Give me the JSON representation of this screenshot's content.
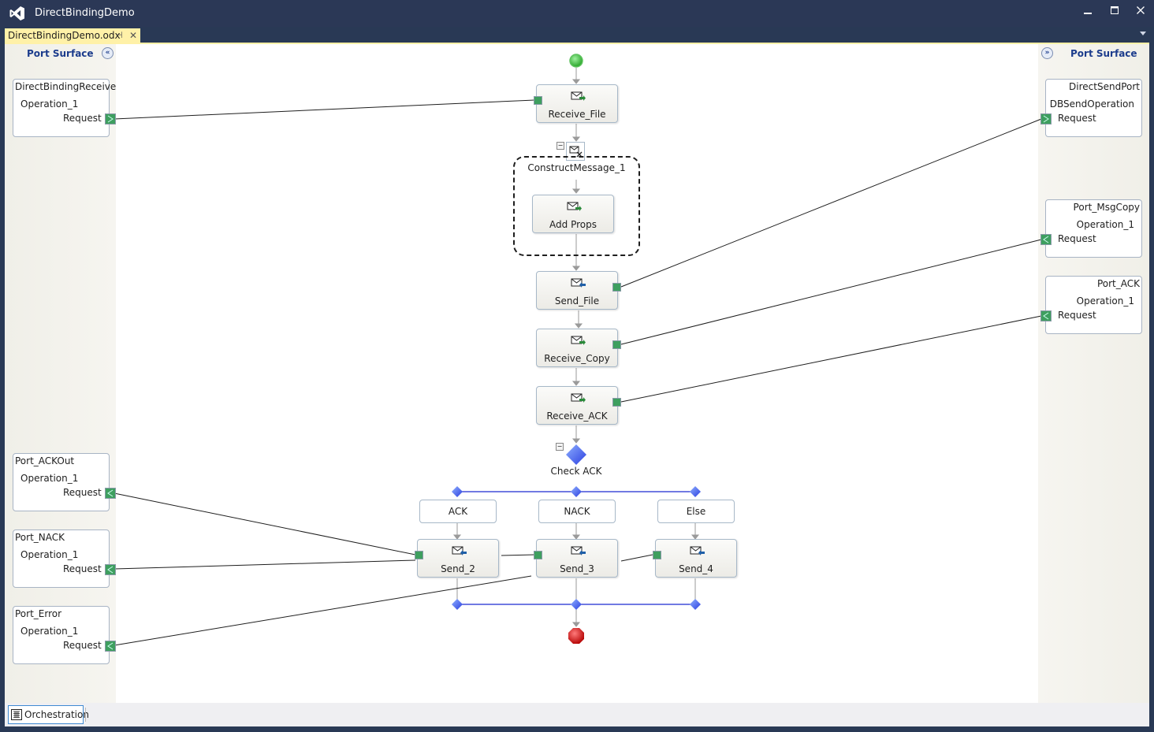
{
  "window": {
    "title": "DirectBindingDemo",
    "controls": {
      "minimize": "minimize",
      "maximize": "maximize",
      "close": "close"
    }
  },
  "tabs": [
    {
      "label": "DirectBindingDemo.odx",
      "active": true,
      "pinned_icon": "pin-icon",
      "close_icon": "close-icon"
    }
  ],
  "port_surfaces": {
    "left": {
      "title": "Port Surface",
      "toggle_icon": "collapse-left-icon"
    },
    "right": {
      "title": "Port Surface",
      "toggle_icon": "expand-right-icon"
    }
  },
  "left_ports": [
    {
      "name": "DirectBindingReceive",
      "operation": "Operation_1",
      "message": "Request",
      "direction": "receive"
    },
    {
      "name": "Port_ACKOut",
      "operation": "Operation_1",
      "message": "Request",
      "direction": "send"
    },
    {
      "name": "Port_NACK",
      "operation": "Operation_1",
      "message": "Request",
      "direction": "send"
    },
    {
      "name": "Port_Error",
      "operation": "Operation_1",
      "message": "Request",
      "direction": "send"
    }
  ],
  "right_ports": [
    {
      "name": "DirectSendPort",
      "operation": "DBSendOperation",
      "message": "Request",
      "direction": "send"
    },
    {
      "name": "Port_MsgCopy",
      "operation": "Operation_1",
      "message": "Request",
      "direction": "receive"
    },
    {
      "name": "Port_ACK",
      "operation": "Operation_1",
      "message": "Request",
      "direction": "receive"
    }
  ],
  "orchestration": {
    "start": "start-shape",
    "shapes": [
      {
        "id": "receive_file",
        "label": "Receive_File",
        "type": "receive"
      },
      {
        "id": "add_props",
        "label": "Add Props",
        "type": "message-assignment"
      },
      {
        "id": "send_file",
        "label": "Send_File",
        "type": "send"
      },
      {
        "id": "receive_copy",
        "label": "Receive_Copy",
        "type": "receive"
      },
      {
        "id": "receive_ack",
        "label": "Receive_ACK",
        "type": "receive"
      }
    ],
    "construct": {
      "label": "ConstructMessage_1"
    },
    "decide": {
      "label": "Check ACK",
      "branches": [
        {
          "label": "ACK",
          "shape": "Send_2"
        },
        {
          "label": "NACK",
          "shape": "Send_3"
        },
        {
          "label": "Else",
          "shape": "Send_4"
        }
      ]
    },
    "end": "end-shape"
  },
  "bottom": {
    "view_tab": "Orchestration"
  },
  "colors": {
    "titlebar": "#2b3856",
    "tab_active": "#fff1a8",
    "port_handle": "#3e9f5f",
    "port_surface_title": "#1c3c8c",
    "decide_diamond": "#3b5bff",
    "branch_line": "#1c2bd0",
    "start": "#33c233",
    "end": "#d41b1b"
  }
}
